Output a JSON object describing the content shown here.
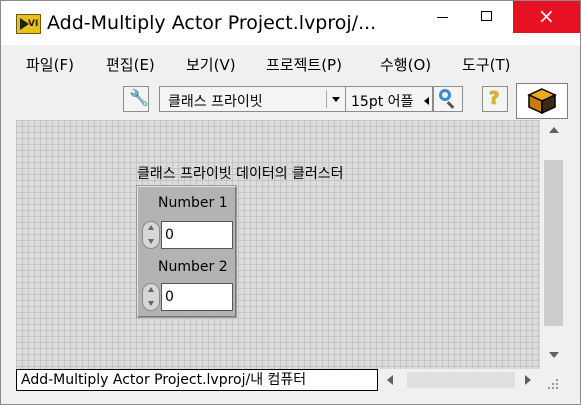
{
  "window": {
    "title": "Add-Multiply Actor Project.lvproj/...",
    "close_glyph": "×",
    "minimize_icon": "minimize-icon",
    "maximize_icon": "maximize-icon",
    "close_icon": "close-icon",
    "app_icon_text": "VI"
  },
  "menu": {
    "items": [
      {
        "label": "파일(F)"
      },
      {
        "label": "편집(E)"
      },
      {
        "label": "보기(V)"
      },
      {
        "label": "프로젝트(P)"
      },
      {
        "label": "수행(O)"
      },
      {
        "label": "도구(T)"
      }
    ]
  },
  "toolbar": {
    "scope_value": "클래스 프라이빗",
    "font_value": "15pt 어플",
    "wrench_glyph": "🔧",
    "help_glyph": "?"
  },
  "cluster": {
    "caption": "클래스 프라이빗 데이터의 클러스터",
    "controls": [
      {
        "label": "Number 1",
        "value": "0"
      },
      {
        "label": "Number 2",
        "value": "0"
      }
    ]
  },
  "status": {
    "path": "Add-Multiply Actor Project.lvproj/내 컴퓨터"
  },
  "colors": {
    "close_button": "#e81123",
    "canvas_bg": "#dcdcdc",
    "cluster_bg": "#b3b3b3"
  }
}
